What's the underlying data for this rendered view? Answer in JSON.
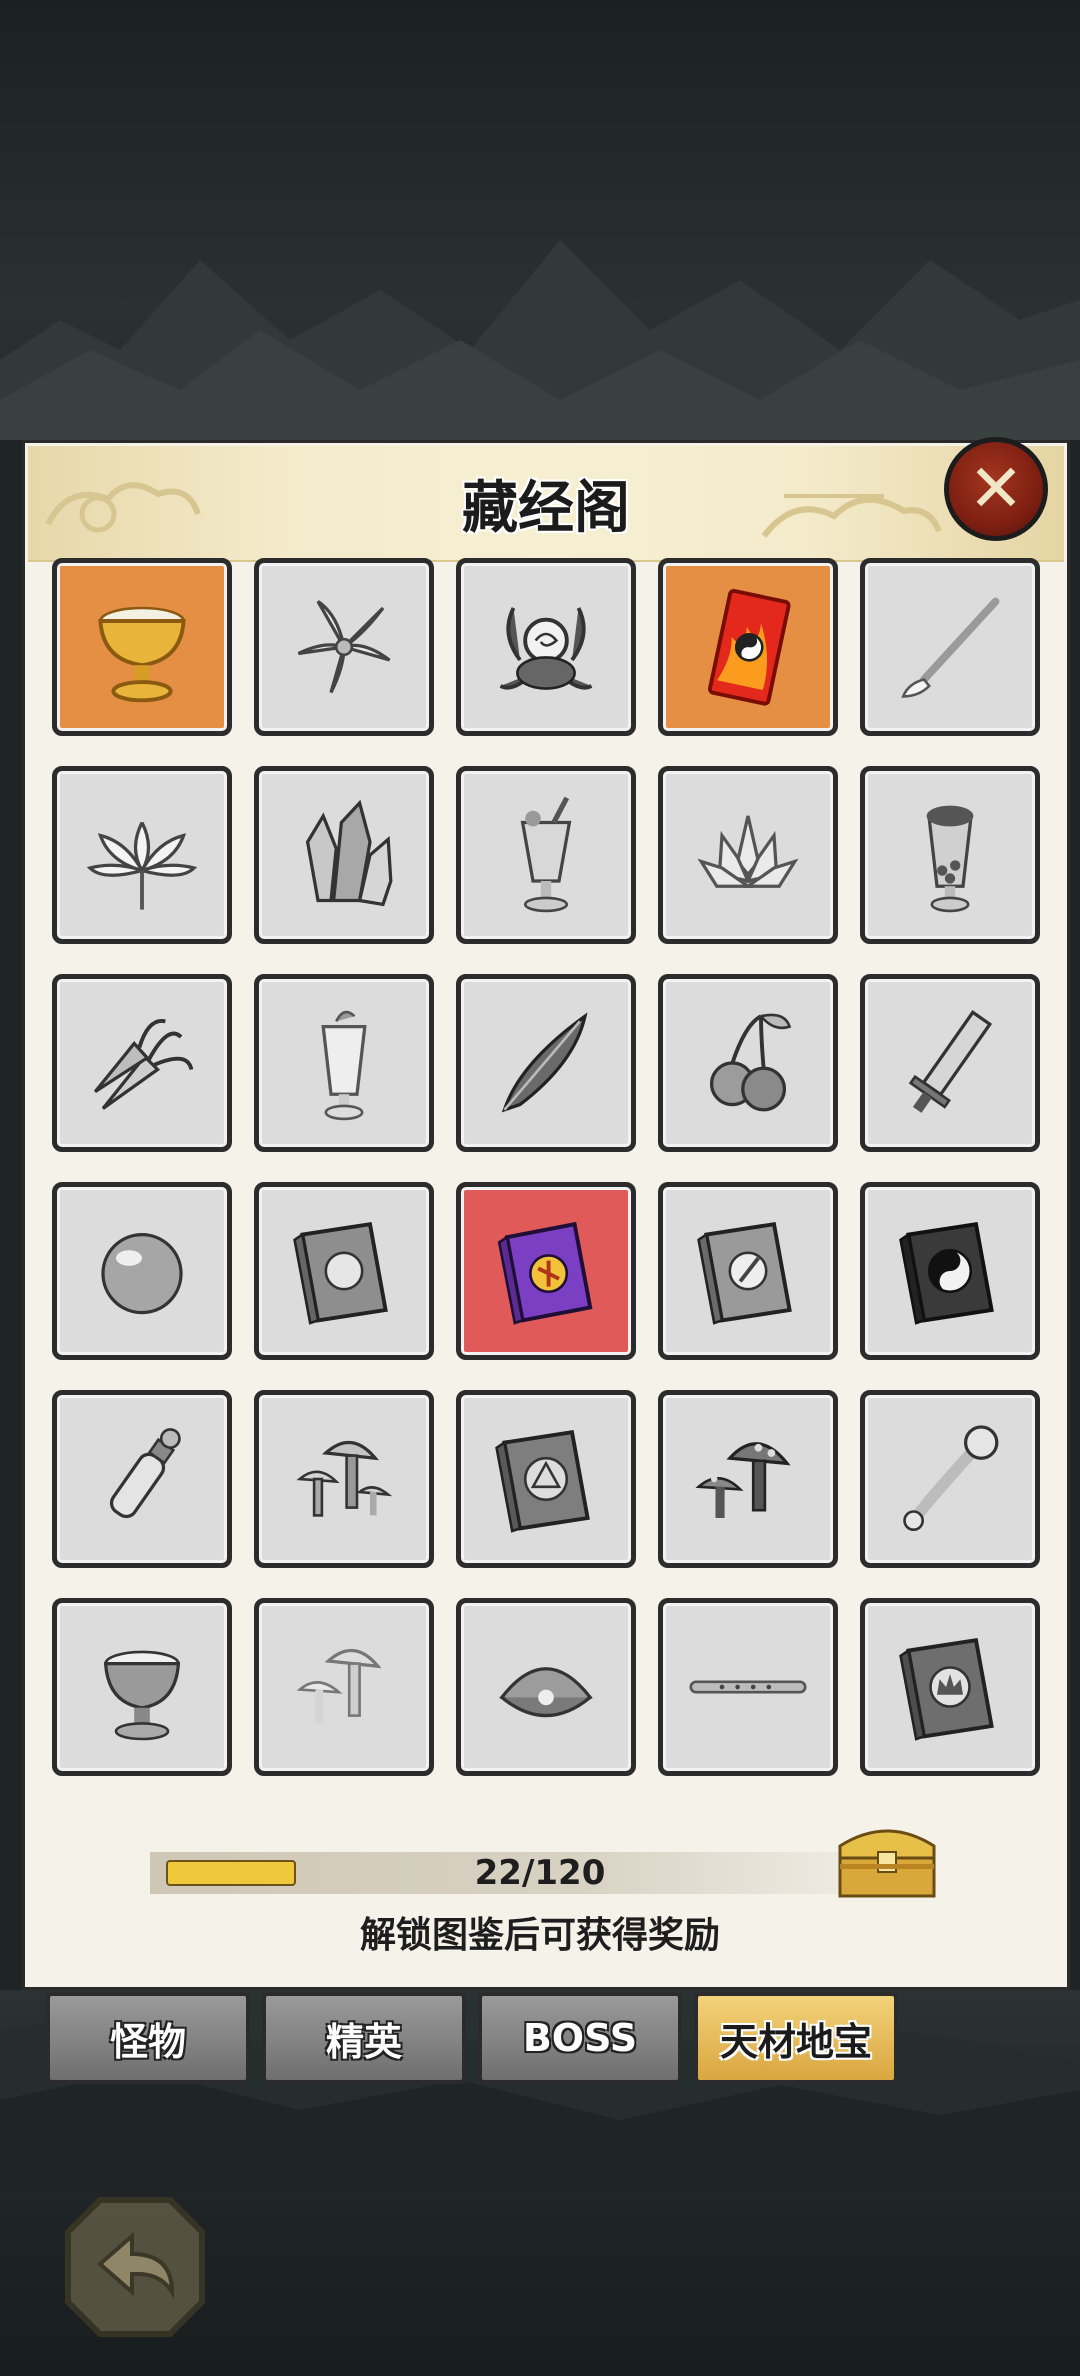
{
  "panel": {
    "title": "藏经阁",
    "close_icon": "close-icon"
  },
  "colors": {
    "unlocked_orange": "#e58f45",
    "selected_red": "#e05a5a",
    "locked_gray": "#dcdcdc",
    "progress_fill": "#f0c83c",
    "active_tab": "#e7b54f"
  },
  "items": [
    {
      "name": "golden-chalice-icon",
      "state": "unlocked"
    },
    {
      "name": "lily-flower-icon",
      "state": "locked"
    },
    {
      "name": "spider-lily-orb-icon",
      "state": "locked"
    },
    {
      "name": "flame-talisman-card-icon",
      "state": "unlocked"
    },
    {
      "name": "brush-icon",
      "state": "locked"
    },
    {
      "name": "lotus-flower-icon",
      "state": "locked"
    },
    {
      "name": "crystal-cluster-icon",
      "state": "locked"
    },
    {
      "name": "juice-glass-icon",
      "state": "locked"
    },
    {
      "name": "crystal-lotus-icon",
      "state": "locked"
    },
    {
      "name": "bubble-tea-icon",
      "state": "locked"
    },
    {
      "name": "carrots-icon",
      "state": "locked"
    },
    {
      "name": "milkshake-icon",
      "state": "locked"
    },
    {
      "name": "feather-icon",
      "state": "locked"
    },
    {
      "name": "cherries-icon",
      "state": "locked"
    },
    {
      "name": "sword-icon",
      "state": "locked"
    },
    {
      "name": "pearl-orb-icon",
      "state": "locked"
    },
    {
      "name": "beast-book-icon",
      "state": "locked"
    },
    {
      "name": "purple-tome-icon",
      "state": "selected"
    },
    {
      "name": "blade-book-icon",
      "state": "locked"
    },
    {
      "name": "yin-yang-book-icon",
      "state": "locked"
    },
    {
      "name": "potion-vial-icon",
      "state": "locked"
    },
    {
      "name": "mushrooms-icon",
      "state": "locked"
    },
    {
      "name": "formation-book-icon",
      "state": "locked"
    },
    {
      "name": "spotted-mushrooms-icon",
      "state": "locked"
    },
    {
      "name": "ruyi-scepter-icon",
      "state": "locked"
    },
    {
      "name": "powder-bowl-icon",
      "state": "locked"
    },
    {
      "name": "pale-mushrooms-icon",
      "state": "locked"
    },
    {
      "name": "clam-shell-icon",
      "state": "locked"
    },
    {
      "name": "bamboo-flute-icon",
      "state": "locked"
    },
    {
      "name": "crown-book-icon",
      "state": "locked"
    }
  ],
  "progress": {
    "text": "22/120",
    "fraction": 0.19,
    "hint": "解锁图鉴后可获得奖励",
    "chest_icon": "treasure-chest-icon"
  },
  "tabs": [
    {
      "label": "怪物",
      "active": false
    },
    {
      "label": "精英",
      "active": false
    },
    {
      "label": "BOSS",
      "active": false
    },
    {
      "label": "天材地宝",
      "active": true
    }
  ],
  "footer": {
    "back_icon": "back-arrow-icon"
  }
}
